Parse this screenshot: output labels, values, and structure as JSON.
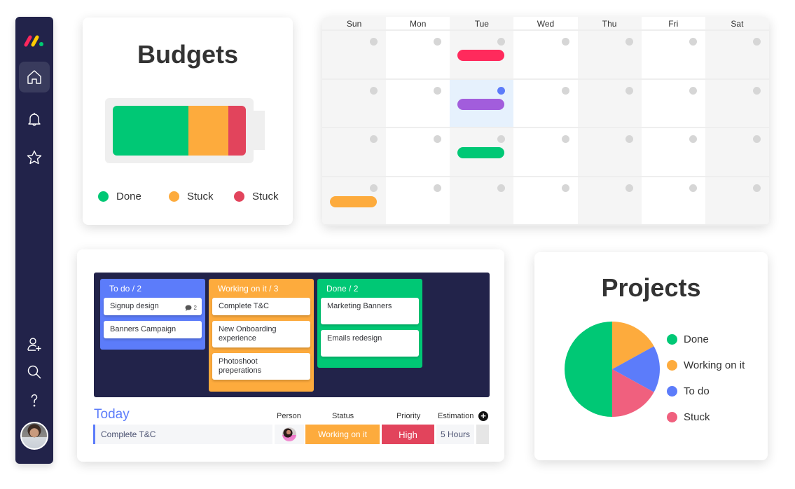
{
  "sidebar": {
    "logo": "monday-logo",
    "items": [
      {
        "name": "home",
        "icon": "home-icon",
        "active": true
      },
      {
        "name": "notifications",
        "icon": "bell-icon",
        "active": false
      },
      {
        "name": "favorites",
        "icon": "star-icon",
        "active": false
      },
      {
        "name": "invite",
        "icon": "add-user-icon",
        "active": false
      },
      {
        "name": "search",
        "icon": "search-icon",
        "active": false
      },
      {
        "name": "help",
        "icon": "help-icon",
        "active": false
      }
    ],
    "avatar": "user-avatar"
  },
  "budgets": {
    "title": "Budgets",
    "segments": [
      {
        "label": "Done",
        "percent": 57,
        "color": "#00c875"
      },
      {
        "label": "Stuck",
        "percent": 30,
        "color": "#fdab3d"
      },
      {
        "label": "Stuck",
        "percent": 13,
        "color": "#e2445c"
      }
    ],
    "legend": [
      {
        "label": "Done",
        "color": "#00c875"
      },
      {
        "label": "Stuck",
        "color": "#fdab3d"
      },
      {
        "label": "Stuck",
        "color": "#e2445c"
      }
    ]
  },
  "calendar": {
    "days": [
      "Sun",
      "Mon",
      "Tue",
      "Wed",
      "Thu",
      "Fri",
      "Sat"
    ],
    "highlighted": {
      "week": 1,
      "day": 2
    },
    "events": [
      {
        "week": 0,
        "day": 2,
        "color": "#ff2a5c"
      },
      {
        "week": 1,
        "day": 2,
        "color": "#a25ddc"
      },
      {
        "week": 2,
        "day": 2,
        "color": "#00c875"
      },
      {
        "week": 3,
        "day": 0,
        "color": "#fdab3d"
      }
    ]
  },
  "board": {
    "columns": [
      {
        "title": "To do / 2",
        "color": "#5c7cfa",
        "cards": [
          {
            "text": "Signup design",
            "comments": "2"
          },
          {
            "text": "Banners Campaign"
          }
        ]
      },
      {
        "title": "Working on it / 3",
        "color": "#fdab3d",
        "cards": [
          {
            "text": "Complete T&C"
          },
          {
            "text": "New Onboarding experience"
          },
          {
            "text": "Photoshoot preperations"
          }
        ]
      },
      {
        "title": "Done / 2",
        "color": "#00c875",
        "cards": [
          {
            "text": "Marketing Banners"
          },
          {
            "text": "Emails redesign"
          }
        ]
      }
    ],
    "today": {
      "title": "Today",
      "headers": {
        "person": "Person",
        "status": "Status",
        "priority": "Priority",
        "estimation": "Estimation"
      },
      "row": {
        "name": "Complete T&C",
        "status": "Working on it",
        "priority": "High",
        "estimation": "5 Hours"
      }
    }
  },
  "projects": {
    "title": "Projects",
    "legend": [
      {
        "label": "Done",
        "color": "#00c875"
      },
      {
        "label": "Working on it",
        "color": "#fdab3d"
      },
      {
        "label": "To do",
        "color": "#5c7cfa"
      },
      {
        "label": "Stuck",
        "color": "#f0607e"
      }
    ]
  },
  "chart_data": {
    "type": "pie",
    "title": "Projects",
    "categories": [
      "Working on it",
      "To do",
      "Stuck",
      "Done"
    ],
    "values": [
      17,
      16,
      17,
      50
    ],
    "colors": [
      "#fdab3d",
      "#5c7cfa",
      "#f0607e",
      "#00c875"
    ],
    "legend": "right"
  }
}
